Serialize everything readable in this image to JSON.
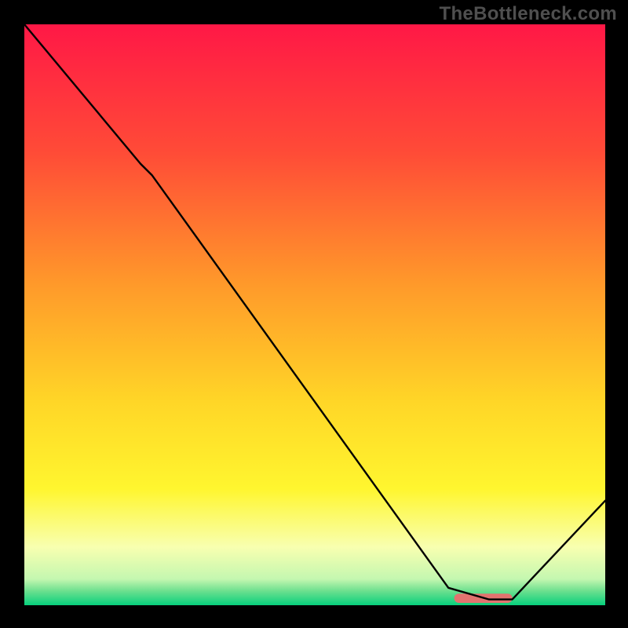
{
  "watermark": "TheBottleneck.com",
  "chart_data": {
    "type": "line",
    "title": "",
    "xlabel": "",
    "ylabel": "",
    "xlim": [
      0,
      100
    ],
    "ylim": [
      0,
      100
    ],
    "grid": false,
    "legend": false,
    "background_gradient": {
      "stops": [
        {
          "offset": 0.0,
          "color": "#ff1846"
        },
        {
          "offset": 0.22,
          "color": "#ff4b37"
        },
        {
          "offset": 0.45,
          "color": "#ff9a2a"
        },
        {
          "offset": 0.65,
          "color": "#ffd627"
        },
        {
          "offset": 0.8,
          "color": "#fff62f"
        },
        {
          "offset": 0.9,
          "color": "#f8ffb0"
        },
        {
          "offset": 0.955,
          "color": "#c4f7b0"
        },
        {
          "offset": 0.975,
          "color": "#6ee08f"
        },
        {
          "offset": 1.0,
          "color": "#07d07d"
        }
      ]
    },
    "series": [
      {
        "name": "curve",
        "color": "#000000",
        "x": [
          0,
          20,
          22,
          73,
          80,
          84,
          100
        ],
        "y": [
          100,
          76,
          74,
          3,
          1,
          1,
          18
        ]
      }
    ],
    "markers": [
      {
        "name": "optimum-band",
        "shape": "rounded-bar",
        "color": "#e2736f",
        "x_start": 74,
        "x_end": 84,
        "y": 1.2,
        "thickness": 1.6
      }
    ]
  }
}
